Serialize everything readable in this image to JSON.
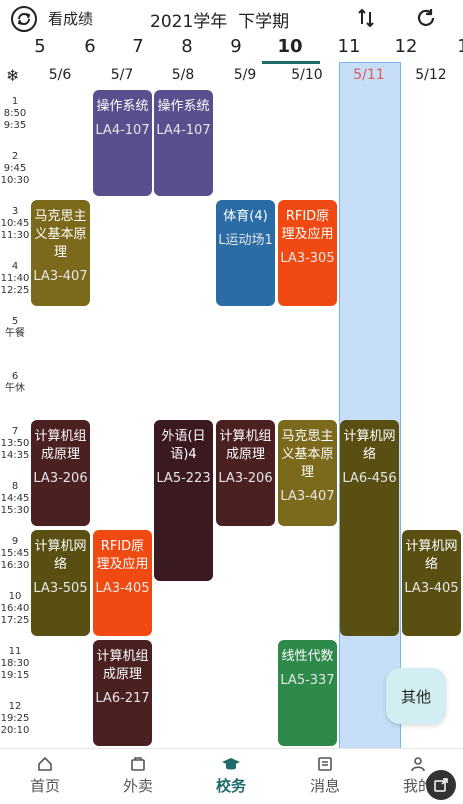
{
  "header": {
    "back_label": "看成绩",
    "title": "2021学年  下学期"
  },
  "weeks": [
    "5",
    "6",
    "7",
    "8",
    "9",
    "10",
    "11",
    "12",
    "1"
  ],
  "current_week": "10",
  "dates": [
    "5/6",
    "5/7",
    "5/8",
    "5/9",
    "5/10",
    "5/11",
    "5/12"
  ],
  "today": "5/11",
  "periods": [
    {
      "num": "1",
      "start": "8:50",
      "end": "9:35"
    },
    {
      "num": "2",
      "start": "9:45",
      "end": "10:30"
    },
    {
      "num": "3",
      "start": "10:45",
      "end": "11:30"
    },
    {
      "num": "4",
      "start": "11:40",
      "end": "12:25"
    },
    {
      "num": "5",
      "start": "午餐",
      "end": ""
    },
    {
      "num": "6",
      "start": "午休",
      "end": ""
    },
    {
      "num": "7",
      "start": "13:50",
      "end": "14:35"
    },
    {
      "num": "8",
      "start": "14:45",
      "end": "15:30"
    },
    {
      "num": "9",
      "start": "15:45",
      "end": "16:30"
    },
    {
      "num": "10",
      "start": "16:40",
      "end": "17:25"
    },
    {
      "num": "11",
      "start": "18:30",
      "end": "19:15"
    },
    {
      "num": "12",
      "start": "19:25",
      "end": "20:10"
    }
  ],
  "courses": [
    {
      "name": "操作系统",
      "room": "LA4-107",
      "day": 1,
      "start": 1,
      "span": 2,
      "color": "#5a4f8e"
    },
    {
      "name": "操作系统",
      "room": "LA4-107",
      "day": 2,
      "start": 1,
      "span": 2,
      "color": "#5a4f8e"
    },
    {
      "name": "马克思主义基本原理",
      "room": "LA3-407",
      "day": 0,
      "start": 3,
      "span": 2,
      "color": "#7c6a1c"
    },
    {
      "name": "体育(4)",
      "room": "L运动场1",
      "day": 3,
      "start": 3,
      "span": 2,
      "color": "#2a6ca6"
    },
    {
      "name": "RFID原理及应用",
      "room": "LA3-305",
      "day": 4,
      "start": 3,
      "span": 2,
      "color": "#f04a12"
    },
    {
      "name": "计算机组成原理",
      "room": "LA3-206",
      "day": 0,
      "start": 7,
      "span": 2,
      "color": "#4a2120"
    },
    {
      "name": "外语(日语)4",
      "room": "LA5-223",
      "day": 2,
      "start": 7,
      "span": 3,
      "color": "#3a1a20"
    },
    {
      "name": "计算机组成原理",
      "room": "LA3-206",
      "day": 3,
      "start": 7,
      "span": 2,
      "color": "#4a2120"
    },
    {
      "name": "马克思主义基本原理",
      "room": "LA3-407",
      "day": 4,
      "start": 7,
      "span": 2,
      "color": "#7c6a1c"
    },
    {
      "name": "计算机网络",
      "room": "LA6-456",
      "day": 5,
      "start": 7,
      "span": 4,
      "color": "#5a4f12"
    },
    {
      "name": "计算机网络",
      "room": "LA3-505",
      "day": 0,
      "start": 9,
      "span": 2,
      "color": "#5a4f12"
    },
    {
      "name": "RFID原理及应用",
      "room": "LA3-405",
      "day": 1,
      "start": 9,
      "span": 2,
      "color": "#f04a12"
    },
    {
      "name": "计算机网络",
      "room": "LA3-405",
      "day": 6,
      "start": 9,
      "span": 2,
      "color": "#5a4f12"
    },
    {
      "name": "计算机组成原理",
      "room": "LA6-217",
      "day": 1,
      "start": 11,
      "span": 2,
      "color": "#4a2120"
    },
    {
      "name": "线性代数",
      "room": "LA5-337",
      "day": 4,
      "start": 11,
      "span": 2,
      "color": "#2e8a4a"
    }
  ],
  "fab_label": "其他",
  "nav": [
    {
      "label": "首页",
      "icon": "home-icon",
      "active": false
    },
    {
      "label": "外卖",
      "icon": "takeout-icon",
      "active": false
    },
    {
      "label": "校务",
      "icon": "graduation-cap-icon",
      "active": true
    },
    {
      "label": "消息",
      "icon": "message-icon",
      "active": false
    },
    {
      "label": "我的",
      "icon": "user-icon",
      "active": false
    }
  ],
  "colors": {
    "accent": "#1d6b6b",
    "today_column": "#c6def7",
    "today_date": "#e05a5a"
  }
}
